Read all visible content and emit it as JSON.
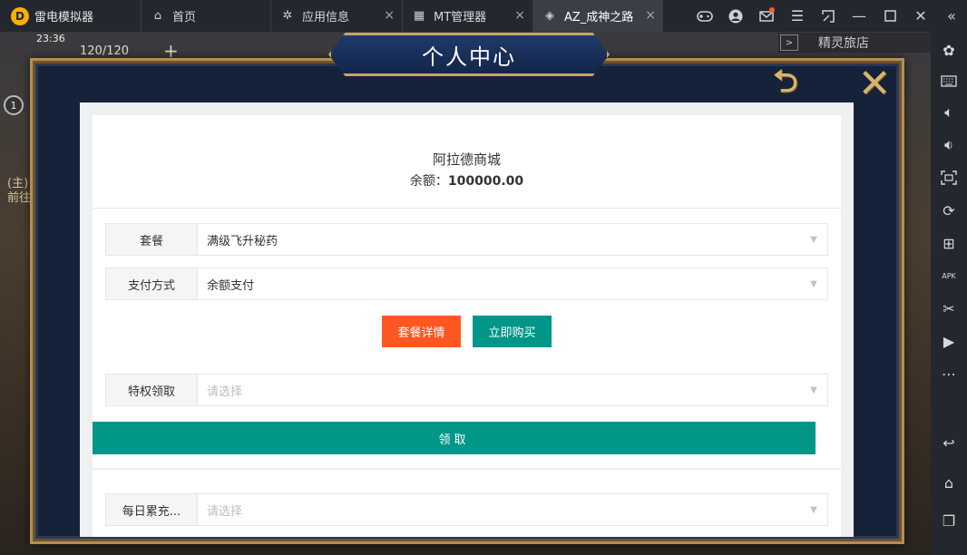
{
  "titlebar": {
    "app_name": "雷电模拟器",
    "tabs": [
      {
        "label": "首页",
        "icon": "home-icon"
      },
      {
        "label": "应用信息",
        "icon": "gear-icon"
      },
      {
        "label": "MT管理器",
        "icon": "app-icon"
      },
      {
        "label": "AZ_成神之路",
        "icon": "game-icon",
        "active": true
      }
    ],
    "actions": [
      "gamepad-icon",
      "user-icon",
      "mail-icon",
      "menu-icon",
      "minimize-to-tray-icon",
      "minimize-icon",
      "maximize-icon",
      "close-icon",
      "collapse-icon"
    ]
  },
  "sidebar": {
    "items": [
      "settings-icon",
      "keyboard-icon",
      "volume-up-icon",
      "volume-down-icon",
      "screenshot-icon",
      "rotate-icon",
      "add-window-icon",
      "apk-icon",
      "scissors-icon",
      "video-icon",
      "more-icon",
      "back-icon",
      "home-icon",
      "recent-apps-icon"
    ]
  },
  "game": {
    "time": "23:36",
    "energy": "120/120",
    "level": "1",
    "banner": "精灵旅店",
    "side_text_1": "(主)",
    "side_text_2": "前往"
  },
  "panel": {
    "title": "个人中心"
  },
  "shop": {
    "name": "阿拉德商城",
    "balance_label": "余额：",
    "balance_value": "100000.00",
    "package_label": "套餐",
    "package_value": "满级飞升秘药",
    "payment_label": "支付方式",
    "payment_value": "余额支付",
    "detail_button": "套餐详情",
    "buy_button": "立即购买",
    "privilege_label": "特权领取",
    "privilege_placeholder": "请选择",
    "claim_button": "领取",
    "daily_label": "每日累充...",
    "daily_placeholder": "请选择"
  },
  "colors": {
    "accent_teal": "#009688",
    "accent_orange": "#ff5722",
    "titlebar_bg": "#25272e",
    "panel_border": "#b28f52"
  }
}
